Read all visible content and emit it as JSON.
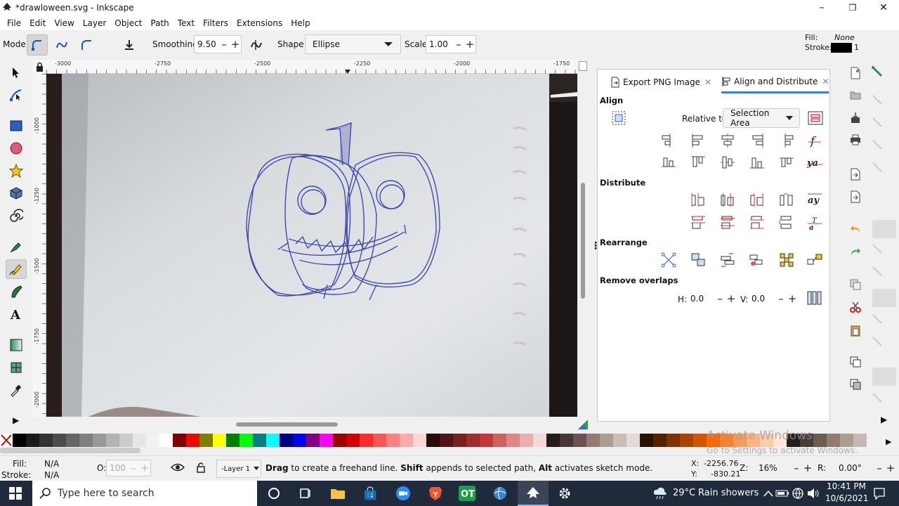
{
  "window": {
    "title": "*drawloween.svg - Inkscape",
    "minimize": "–",
    "maximize": "❐",
    "close": "✕"
  },
  "menu": [
    "File",
    "Edit",
    "View",
    "Layer",
    "Object",
    "Path",
    "Text",
    "Filters",
    "Extensions",
    "Help"
  ],
  "toolcontrols": {
    "mode_label": "Mode:",
    "smoothing_label": "Smoothing:",
    "smoothing_value": "9.50",
    "shape_label": "Shape:",
    "shape_value": "Ellipse",
    "scale_label": "Scale:",
    "scale_value": "1.00",
    "fill_label": "Fill:",
    "fill_value": "None",
    "stroke_label": "Stroke:",
    "stroke_width": "1",
    "plus": "+",
    "minus": "–"
  },
  "ruler": {
    "h_ticks": [
      "-3000",
      "-2750",
      "-2500",
      "-2250",
      "-2000",
      "-1750"
    ],
    "v_ticks": [
      "-1000",
      "-1250",
      "-1500",
      "-1750",
      "-2000"
    ]
  },
  "dock": {
    "tabs": [
      "Export PNG Image",
      "Align and Distribute"
    ],
    "align_label": "Align",
    "relative_to_label": "Relative to:",
    "relative_to_value": "Selection Area",
    "distribute_label": "Distribute",
    "rearrange_label": "Rearrange",
    "remove_overlaps_label": "Remove overlaps",
    "h_label": "H:",
    "h_value": "0.0",
    "v_label": "V:",
    "v_value": "0.0"
  },
  "palette_colors": [
    "#000000",
    "#1a1a1a",
    "#333333",
    "#4d4d4d",
    "#666666",
    "#808080",
    "#999999",
    "#b3b3b3",
    "#cccccc",
    "#e6e6e6",
    "#f2f2f2",
    "#ffffff",
    "#800000",
    "#ff0000",
    "#808000",
    "#ffff00",
    "#008000",
    "#00ff00",
    "#008080",
    "#00ffff",
    "#000080",
    "#0000ff",
    "#800080",
    "#ff00ff",
    "#a00000",
    "#d40000",
    "#ff2a2a",
    "#ff5555",
    "#ff8080",
    "#ffaaaa",
    "#ffd5d5",
    "#280b0b",
    "#501616",
    "#782121",
    "#a02c2c",
    "#c83737",
    "#d35f5f",
    "#de8787",
    "#e9afaf",
    "#f4d7d7",
    "#241c1c",
    "#483737",
    "#6c5353",
    "#917c6f",
    "#ac9d93",
    "#c8beb7",
    "#e3dbdb",
    "#2b1100",
    "#552200",
    "#803300",
    "#aa4400",
    "#d45500",
    "#ff6600",
    "#ff7f2a",
    "#ff9955",
    "#ffb380",
    "#ffccaa",
    "#ffe6d5",
    "#241f1c",
    "#483e37",
    "#6c5d53",
    "#917c6f",
    "#ac9d93",
    "#c8b7b7"
  ],
  "watermark": {
    "line1": "Activate Windows",
    "line2": "Go to Settings to activate Windows."
  },
  "status": {
    "fill_label": "Fill:",
    "fill_value": "N/A",
    "stroke_label": "Stroke:",
    "stroke_value": "N/A",
    "opacity_label": "O:",
    "opacity_value": "100",
    "layer": "-Layer 1",
    "message_drag": "Drag",
    "message_1": " to create a freehand line. ",
    "message_shift": "Shift",
    "message_2": " appends to selected path, ",
    "message_alt": "Alt",
    "message_3": " activates sketch mode.",
    "x_label": "X:",
    "x_value": "-2256.76",
    "y_label": "Y:",
    "y_value": "-830.21",
    "z_label": "Z:",
    "zoom_value": "16%",
    "r_label": "R:",
    "rotation_value": "0.00°"
  },
  "taskbar": {
    "search_placeholder": "Type here to search",
    "temperature": "29°C",
    "weather": "Rain showers",
    "time": "10:41 PM",
    "date": "10/6/2021"
  }
}
